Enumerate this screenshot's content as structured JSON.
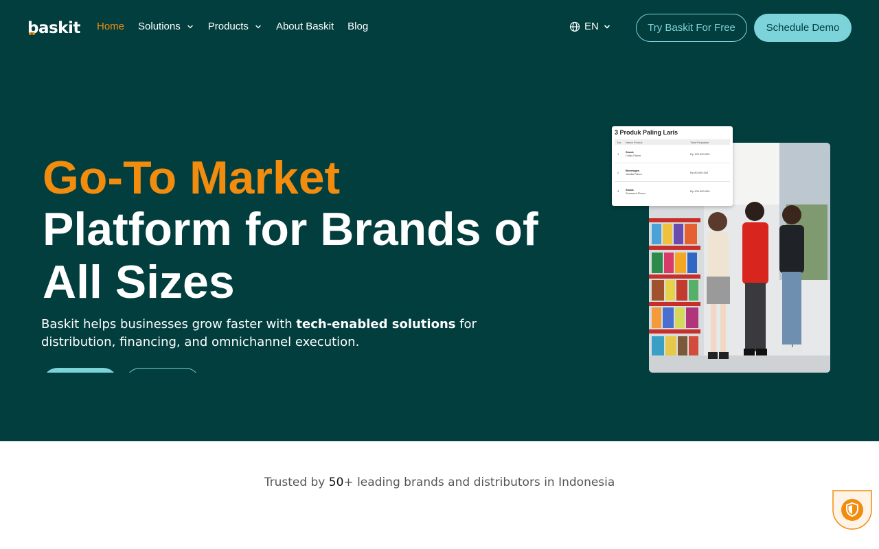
{
  "brand": {
    "logo_text": "baskit",
    "accent": "#F28C0F",
    "primary_bg": "#023E3E",
    "teal": "#7DD3DA"
  },
  "nav": {
    "items": [
      {
        "label": "Home",
        "active": true,
        "has_dropdown": false
      },
      {
        "label": "Solutions",
        "active": false,
        "has_dropdown": true
      },
      {
        "label": "Products",
        "active": false,
        "has_dropdown": true
      },
      {
        "label": "About Baskit",
        "active": false,
        "has_dropdown": false
      },
      {
        "label": "Blog",
        "active": false,
        "has_dropdown": false
      }
    ],
    "language": "EN",
    "try_free_label": "Try Baskit For Free",
    "schedule_demo_label": "Schedule Demo"
  },
  "hero": {
    "title_accent": "Go-To Market",
    "title_main": "Platform for Brands of All Sizes",
    "desc_before": "Baskit helps businesses grow faster with ",
    "desc_bold": "tech-enabled solutions",
    "desc_after": " for distribution, financing, and omnichannel execution.",
    "card": {
      "title": "3 Produk Paling Laris",
      "headers": {
        "no": "No.",
        "name": "Nama Produk",
        "total": "Total Penjualan"
      },
      "rows": [
        {
          "no": "1",
          "name": "Snack",
          "variant": "Chips Flavor",
          "total": "Rp 120.000.000"
        },
        {
          "no": "2",
          "name": "Beverages",
          "variant": "Vanilla Flavor",
          "total": "Rp 80.000.000"
        },
        {
          "no": "3",
          "name": "Snack",
          "variant": "Seaweed Flavor",
          "total": "Rp 100.000.000"
        }
      ]
    }
  },
  "trusted": {
    "prefix": "Trusted by ",
    "count": "50",
    "suffix": "+ leading brands and distributors in Indonesia"
  },
  "icons": [
    "globe-icon",
    "chevron-down-icon",
    "shield-icon"
  ]
}
